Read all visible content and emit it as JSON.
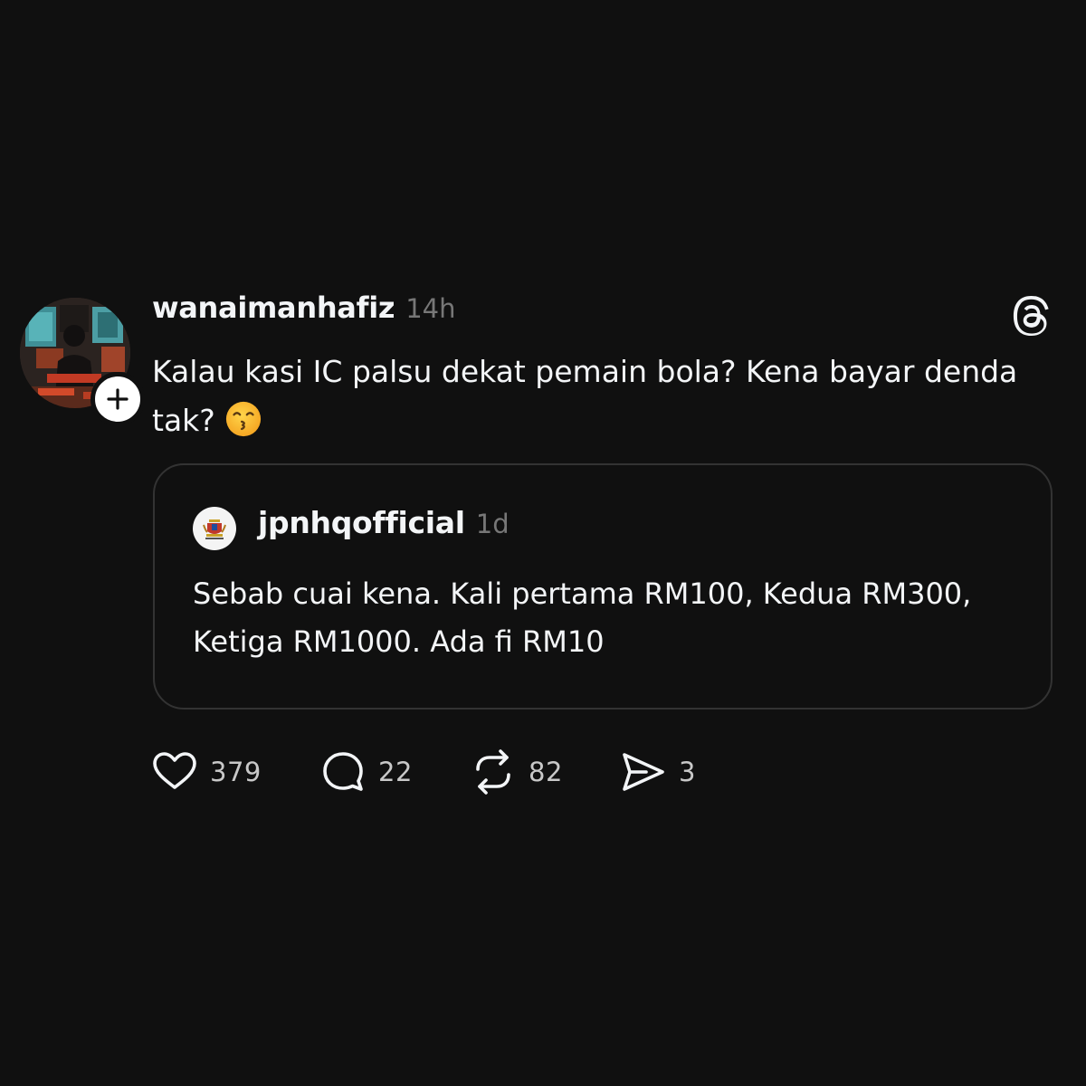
{
  "post": {
    "username": "wanaimanhafiz",
    "timestamp": "14h",
    "text": "Kalau kasi IC palsu dekat pemain bola? Kena bayar denda tak?",
    "emoji": "kissing-face-with-smiling-eyes",
    "follow_icon": "plus-icon",
    "platform_icon": "threads-logo-icon"
  },
  "quoted_post": {
    "username": "jpnhqofficial",
    "timestamp": "1d",
    "text": "Sebab cuai kena. Kali pertama RM100, Kedua RM300, Ketiga RM1000. Ada fi RM10"
  },
  "actions": {
    "likes": "379",
    "replies": "22",
    "reposts": "82",
    "shares": "3"
  },
  "colors": {
    "background": "#101010",
    "primary_text": "#f3f5f7",
    "secondary_text": "#777777",
    "border": "#333333"
  }
}
